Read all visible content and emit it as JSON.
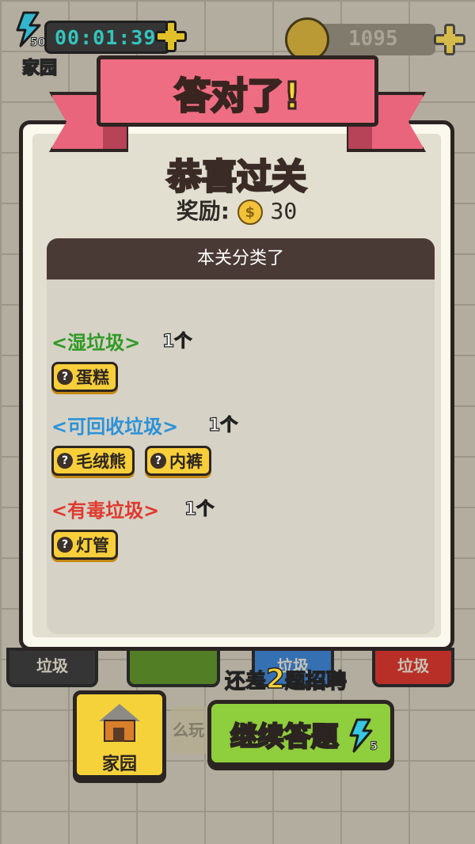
{
  "hud": {
    "energy_count": "50",
    "home_label": "家园",
    "timer": "00:01:39",
    "coins": "1095"
  },
  "dialog": {
    "ribbon_title": "答对了!",
    "title": "恭喜过关",
    "reward_label": "奖励:",
    "reward_amount": "30",
    "list_header": "本关分类了",
    "categories": [
      {
        "name": "<湿垃圾>",
        "count": "1个",
        "color": "#2f9a24",
        "items": [
          "蛋糕"
        ]
      },
      {
        "name": "<可回收垃圾>",
        "count": "1个",
        "color": "#2b92d8",
        "items": [
          "毛绒熊",
          "内裤"
        ]
      },
      {
        "name": "<有毒垃圾>",
        "count": "1个",
        "color": "#e0392e",
        "items": [
          "灯管"
        ]
      }
    ],
    "tag_icon": "?"
  },
  "background": {
    "bin_labels": [
      "垃圾",
      "",
      "垃圾",
      "垃圾"
    ],
    "faint_text": "么玩"
  },
  "bottom": {
    "status_prefix": "还差",
    "status_number": "2",
    "status_mid": "题",
    "status_suffix": "招聘",
    "home_button": "家园",
    "continue_button": "继续答题",
    "continue_cost": "5"
  }
}
